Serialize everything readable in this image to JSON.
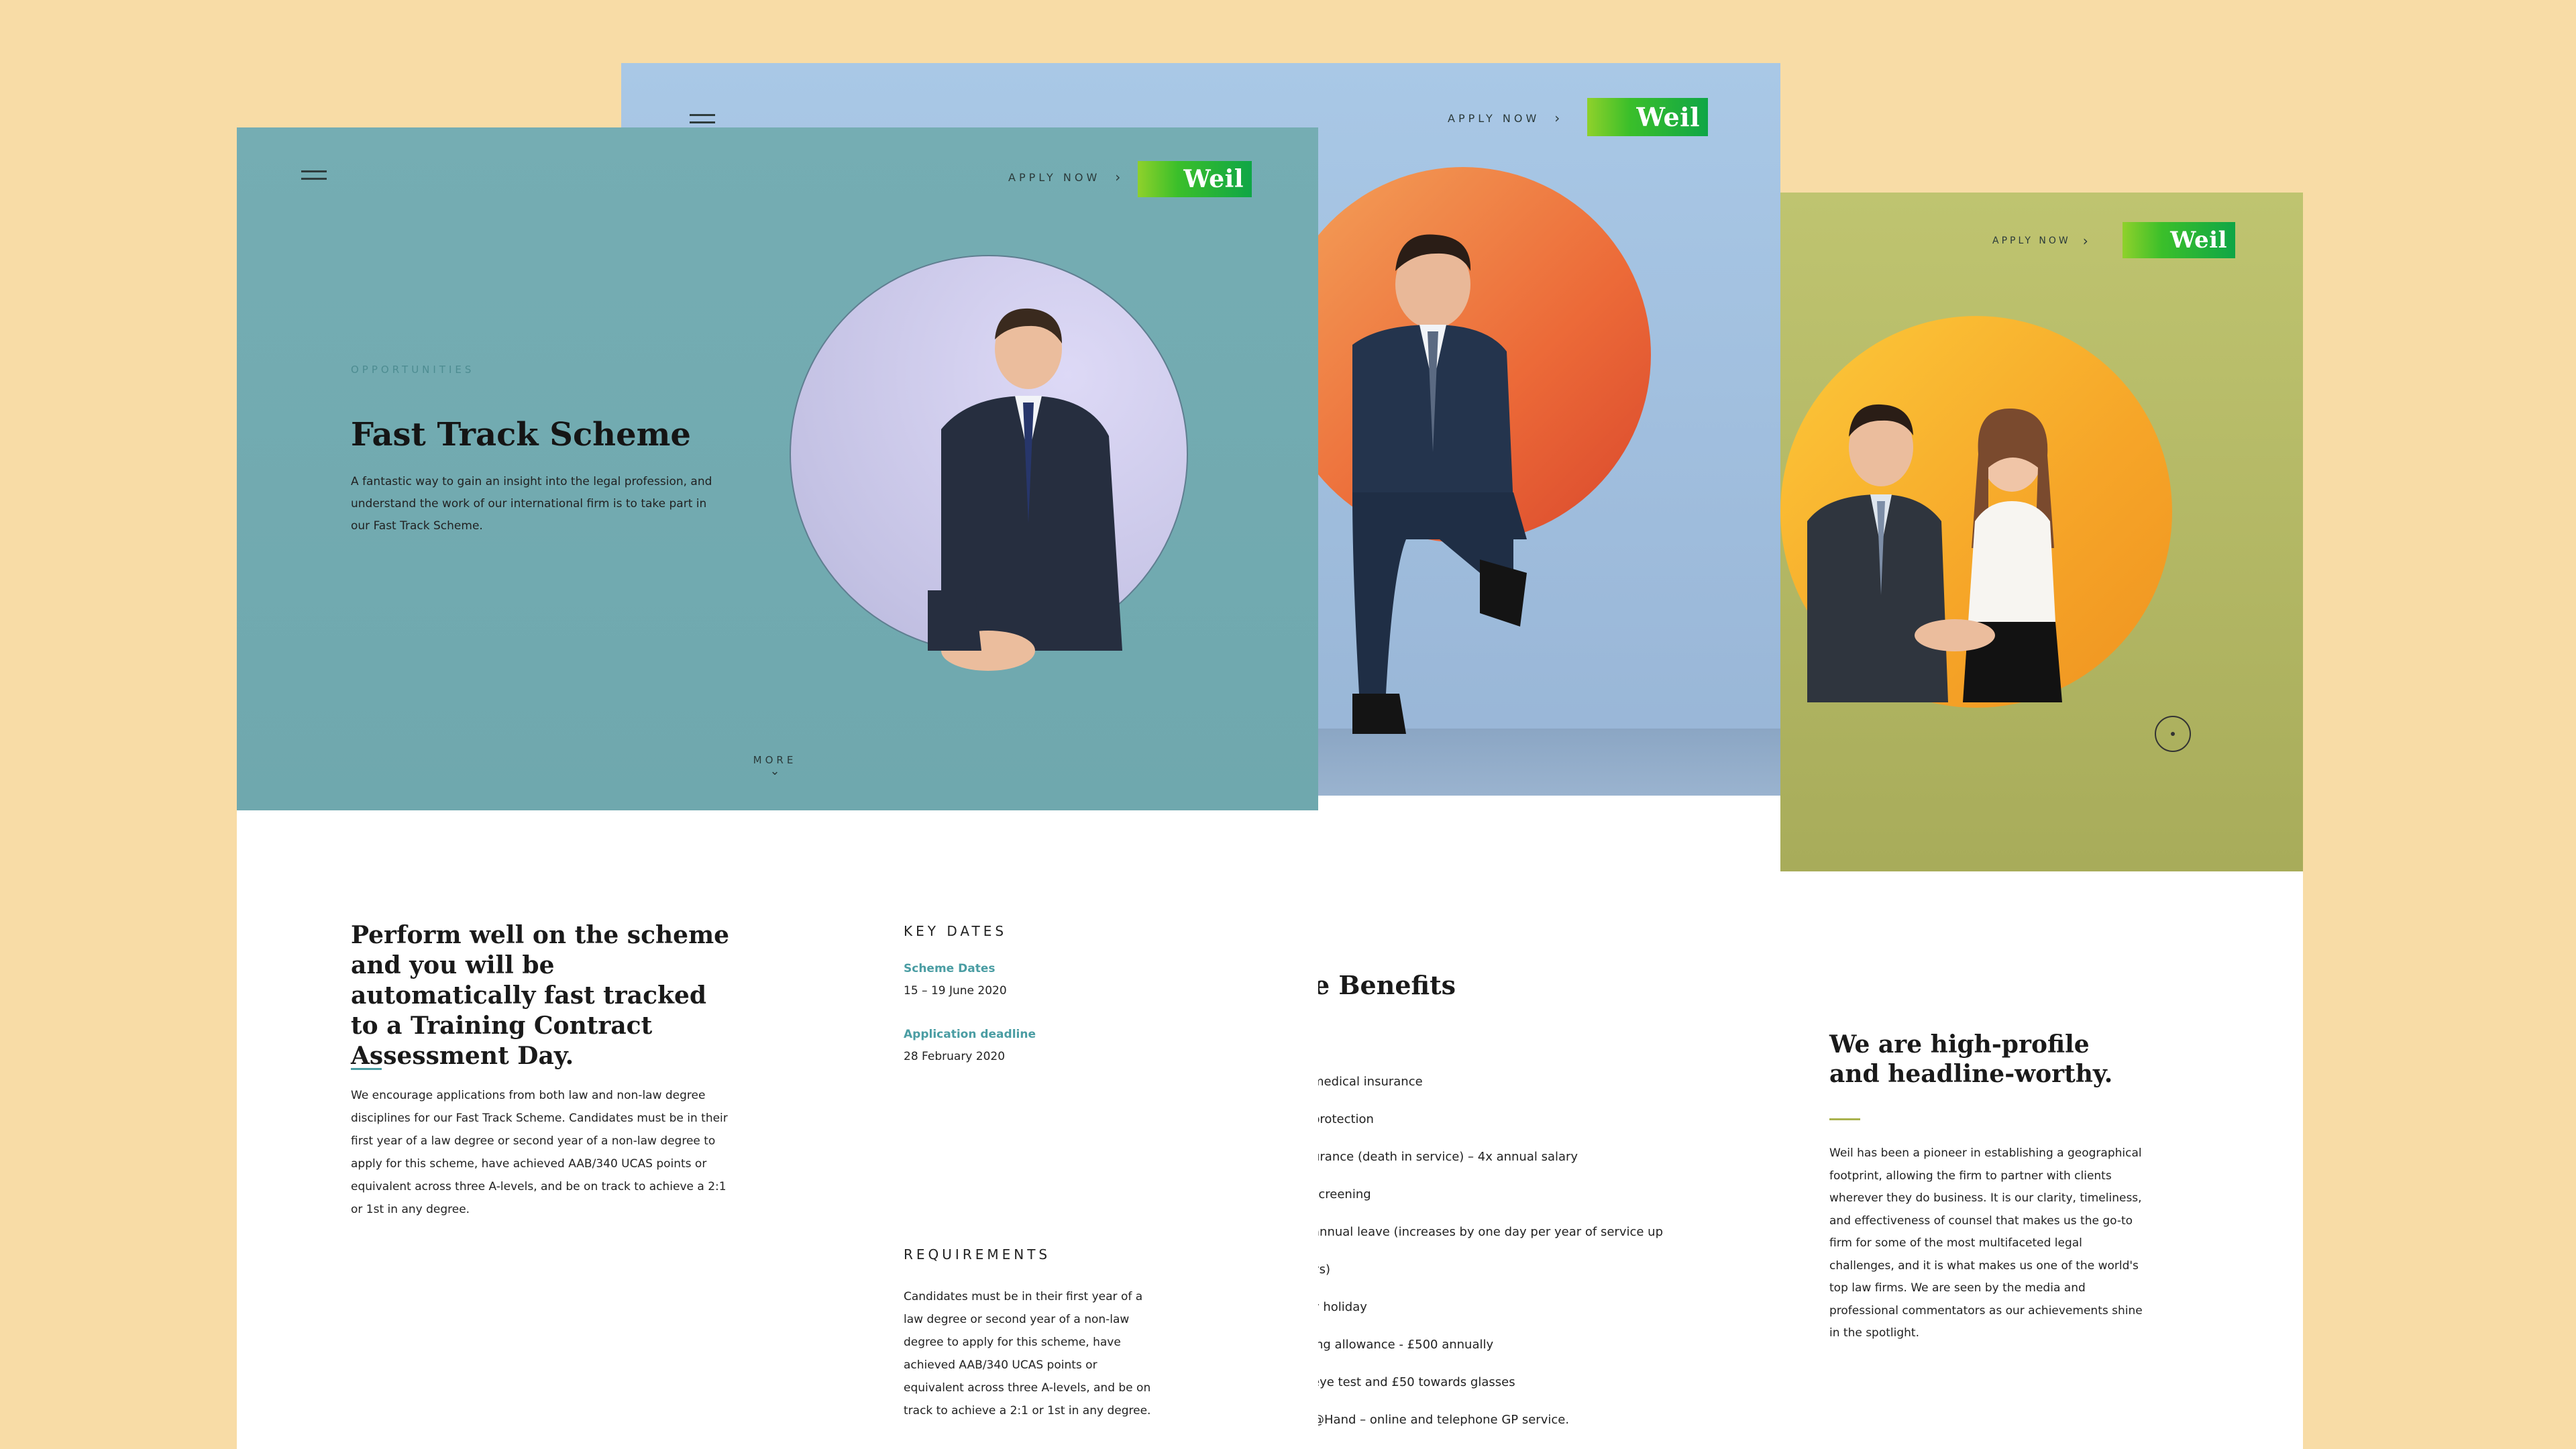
{
  "left_card": {
    "apply_label": "APPLY NOW",
    "logo_text": "Weil",
    "eyebrow": "OPPORTUNITIES",
    "title": "Fast Track Scheme",
    "intro": "A fantastic way to gain an insight into the legal profession, and understand the work of our international firm is to take part in our Fast Track Scheme.",
    "more_label": "MORE",
    "heading": "Perform well on the scheme and you will be automatically fast tracked to a Training Contract Assessment Day.",
    "body": "We encourage applications from both law and non-law degree disciplines for our Fast Track Scheme. Candidates must be in their first year of a law degree or second year of a non-law degree to apply for this scheme, have achieved AAB/340 UCAS points or equivalent across three A-levels, and be on track to achieve a 2:1 or 1st in any degree.",
    "key_dates_title": "KEY DATES",
    "scheme_dates_label": "Scheme Dates",
    "scheme_dates_value": "15 – 19 June 2020",
    "deadline_label": "Application deadline",
    "deadline_value": "28 February 2020",
    "requirements_title": "REQUIREMENTS",
    "requirements_body": "Candidates must be in their first year of a law degree or second year of a non-law degree to apply for this scheme, have achieved AAB/340 UCAS points or equivalent across three A-levels, and be on track to achieve a 2:1 or 1st in any degree."
  },
  "middle_card": {
    "apply_label": "APPLY NOW",
    "logo_text": "Weil",
    "benefits_title": "e Benefits",
    "benefits": [
      "medical insurance",
      "protection",
      "urance (death in service) – 4x annual salary",
      "screening",
      "annual leave (increases by one day per year of service up",
      "ys)",
      "y holiday",
      "ing allowance - £500 annually",
      "eye test and £50 towards glasses",
      "@Hand – online and telephone GP service."
    ]
  },
  "right_card": {
    "apply_label": "APPLY NOW",
    "logo_text": "Weil",
    "heading": "We are high-profile and headline-worthy.",
    "body": "Weil has been a pioneer in establishing a geographical footprint, allowing the firm to partner with clients wherever they do business. It is our clarity, timeliness, and effectiveness of counsel that makes us the go-to firm for some of the most multifaceted legal challenges, and it is what makes us one of the world's top law firms. We are seen by the media and professional commentators as our achievements shine in the spotlight."
  },
  "colors": {
    "page_bg": "#f8dca6",
    "teal": "#73aeb4",
    "blue": "#a6c4e2",
    "olive": "#b1b66a",
    "green_accent": "#4a9da3",
    "logo_green": "#2bb33a"
  }
}
